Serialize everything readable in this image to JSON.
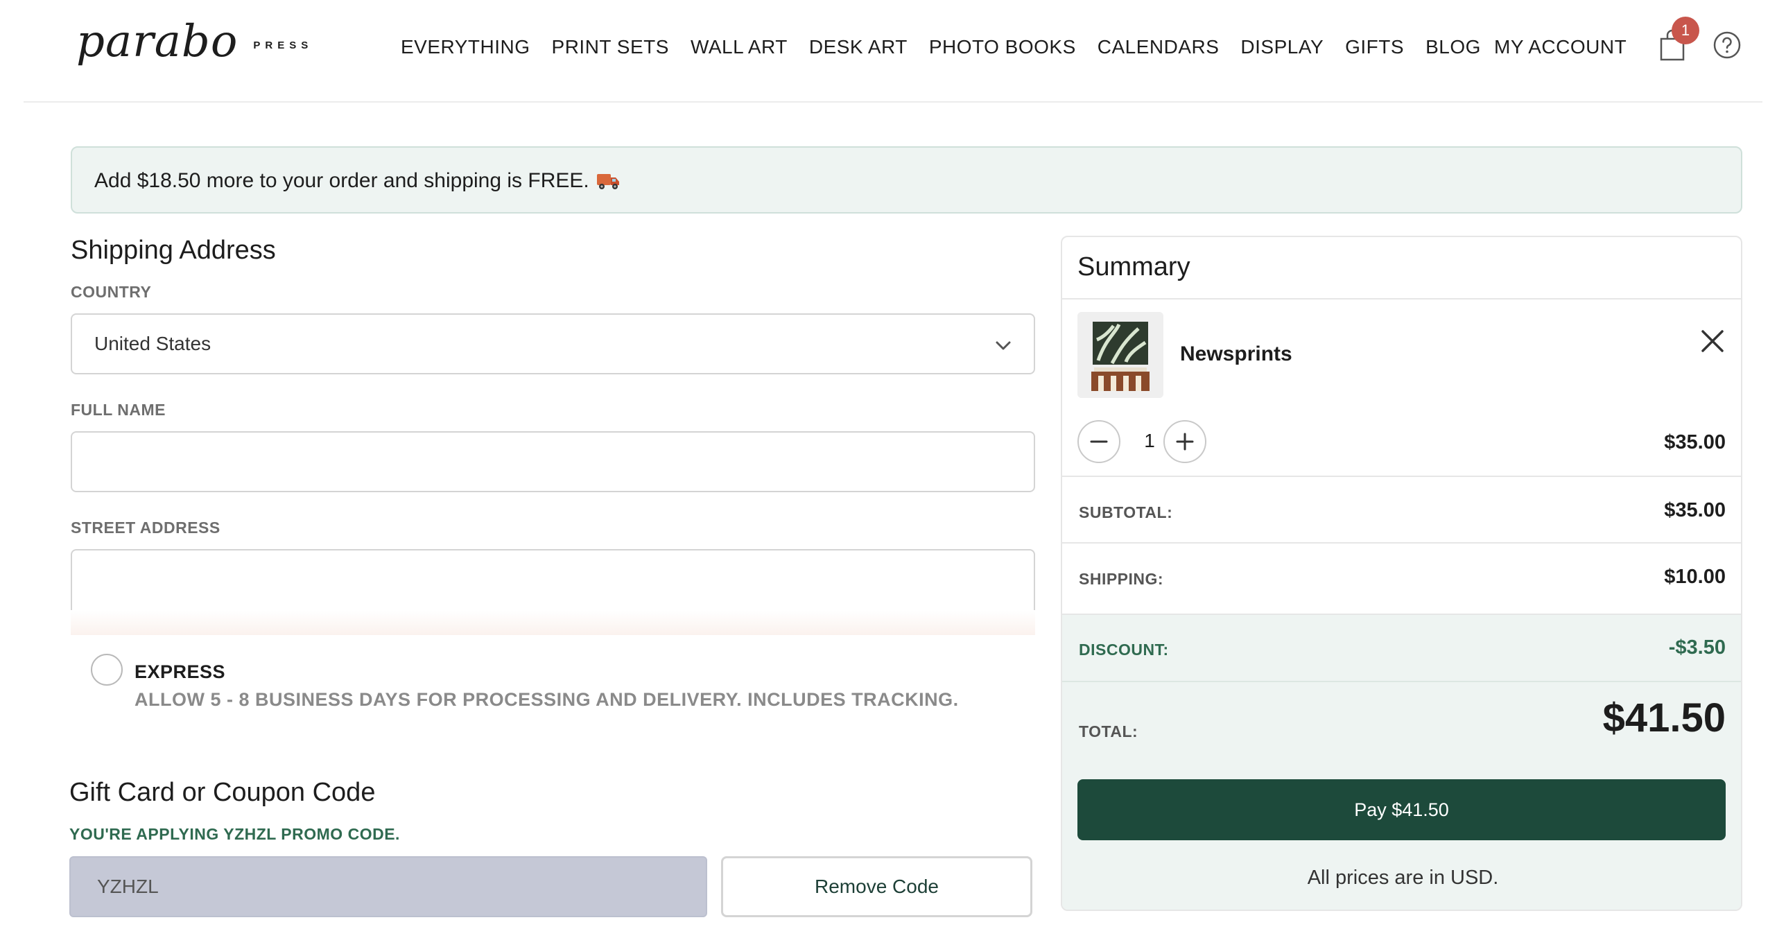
{
  "brand": {
    "script": "parabo",
    "suffix": "PRESS"
  },
  "nav": {
    "items": [
      "EVERYTHING",
      "PRINT SETS",
      "WALL ART",
      "DESK ART",
      "PHOTO BOOKS",
      "CALENDARS",
      "DISPLAY",
      "GIFTS",
      "BLOG"
    ],
    "account": "MY ACCOUNT",
    "cart_count": "1"
  },
  "banner": {
    "text": "Add $18.50 more to your order and shipping is FREE.",
    "icon": "truck-icon"
  },
  "shipping": {
    "title": "Shipping Address",
    "country_label": "COUNTRY",
    "country_value": "United States",
    "fullname_label": "FULL NAME",
    "fullname_value": "",
    "street_label": "STREET ADDRESS",
    "street_value": "",
    "option_title": "EXPRESS",
    "option_desc": "ALLOW 5 - 8 BUSINESS DAYS FOR PROCESSING AND DELIVERY. INCLUDES TRACKING."
  },
  "coupon": {
    "title": "Gift Card or Coupon Code",
    "note": "YOU'RE APPLYING YZHZL PROMO CODE.",
    "code_value": "YZHZL",
    "remove_label": "Remove Code"
  },
  "summary": {
    "title": "Summary",
    "product_name": "Newsprints",
    "quantity": "1",
    "item_price": "$35.00",
    "subtotal_label": "SUBTOTAL:",
    "subtotal_value": "$35.00",
    "shipping_label": "SHIPPING:",
    "shipping_value": "$10.00",
    "discount_label": "DISCOUNT:",
    "discount_value": "-$3.50",
    "total_label": "TOTAL:",
    "total_value": "$41.50",
    "pay_label": "Pay $41.50",
    "currency_note": "All prices are in USD."
  },
  "colors": {
    "accent": "#1d4a3b",
    "badge": "#c8564c",
    "promo_green": "#2f6a50",
    "banner_bg": "#eef4f2"
  }
}
